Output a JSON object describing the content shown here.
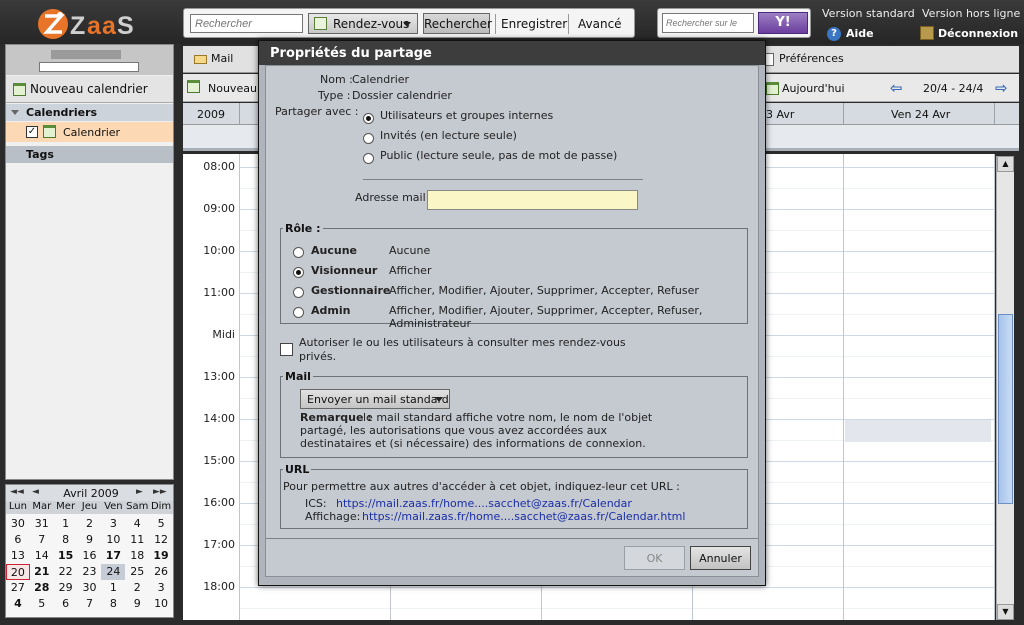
{
  "header": {
    "logo_text": "ZaaS",
    "search_placeholder": "Rechercher",
    "search_type": "Rendez-vous",
    "search_button": "Rechercher",
    "save_button": "Enregistrer",
    "advanced_button": "Avancé",
    "web_search_placeholder": "Rechercher sur le",
    "yahoo_label": "Y!",
    "standard_version": "Version standard",
    "offline_version": "Version hors ligne",
    "help": "Aide",
    "logout": "Déconnexion"
  },
  "sidebar": {
    "new_calendar": "Nouveau calendrier",
    "calendars_header": "Calendriers",
    "calendar_item": "Calendrier",
    "tags_header": "Tags"
  },
  "mini_calendar": {
    "title": "Avril 2009",
    "nav_prev_year": "◄◄",
    "nav_prev": "◄",
    "nav_next": "►",
    "nav_next_year": "►►",
    "days_of_week": [
      "Lun",
      "Mar",
      "Mer",
      "Jeu",
      "Ven",
      "Sam",
      "Dim"
    ],
    "weeks": [
      [
        "30",
        "31",
        "1",
        "2",
        "3",
        "4",
        "5"
      ],
      [
        "6",
        "7",
        "8",
        "9",
        "10",
        "11",
        "12"
      ],
      [
        "13",
        "14",
        "15",
        "16",
        "17",
        "18",
        "19"
      ],
      [
        "20",
        "21",
        "22",
        "23",
        "24",
        "25",
        "26"
      ],
      [
        "27",
        "28",
        "29",
        "30",
        "1",
        "2",
        "3"
      ],
      [
        "4",
        "5",
        "6",
        "7",
        "8",
        "9",
        "10"
      ]
    ],
    "bold_cells": [
      "2-2",
      "2-4",
      "2-6",
      "3-1",
      "4-1",
      "5-0"
    ],
    "today_cell": "3-0",
    "selected_cell": "3-4"
  },
  "main": {
    "tab_mail": "Mail",
    "tab_preferences": "Préférences",
    "new_button": "Nouveau",
    "today_button": "Aujourd'hui",
    "date_range": "20/4 - 24/4",
    "year_label": "2009",
    "day_thu_partial": "3 Avr",
    "day_fri": "Ven 24 Avr",
    "times": [
      "08:00",
      "09:00",
      "10:00",
      "11:00",
      "Midi",
      "13:00",
      "14:00",
      "15:00",
      "16:00",
      "17:00",
      "18:00"
    ]
  },
  "dialog": {
    "title": "Propriétés du partage",
    "name_label": "Nom :",
    "name_value": "Calendrier",
    "type_label": "Type :",
    "type_value": "Dossier calendrier",
    "share_with_label": "Partager avec :",
    "share_options": [
      "Utilisateurs et groupes internes",
      "Invités (en lecture seule)",
      "Public (lecture seule, pas de mot de passe)"
    ],
    "mail_address_label": "Adresse mail :",
    "role_legend": "Rôle :",
    "roles": [
      {
        "name": "Aucune",
        "desc": "Aucune"
      },
      {
        "name": "Visionneur",
        "desc": "Afficher"
      },
      {
        "name": "Gestionnaire",
        "desc": "Afficher, Modifier, Ajouter, Supprimer, Accepter, Refuser"
      },
      {
        "name": "Admin",
        "desc": "Afficher, Modifier, Ajouter, Supprimer, Accepter, Refuser, Administrateur"
      }
    ],
    "private_line1": "Autoriser le ou les utilisateurs à consulter mes rendez-vous",
    "private_line2": "privés.",
    "mail_legend": "Mail",
    "mail_option": "Envoyer un mail standard",
    "remark_label": "Remarque :",
    "remark_line1": "le mail standard affiche votre nom, le nom de l'objet",
    "remark_line2": "partagé, les autorisations que vous avez accordées aux",
    "remark_line3": "destinataires et (si nécessaire) des informations de connexion.",
    "url_legend": "URL",
    "url_intro": "Pour permettre aux autres d'accéder à cet objet, indiquez-leur cet URL :",
    "ics_label": "ICS:",
    "ics_url": "https://mail.zaas.fr/home....sacchet@zaas.fr/Calendar",
    "view_label": "Affichage:",
    "view_url": "https://mail.zaas.fr/home....sacchet@zaas.fr/Calendar.html",
    "ok_button": "OK",
    "cancel_button": "Annuler"
  },
  "colors": {
    "header_bg": "#2e2e2e",
    "dialog_title_bg": "#3d3d3d",
    "selected_calendar_bg": "#fcd9b4",
    "mail_input_bg": "#fbf6c5",
    "link_color": "#1a2ea8"
  }
}
